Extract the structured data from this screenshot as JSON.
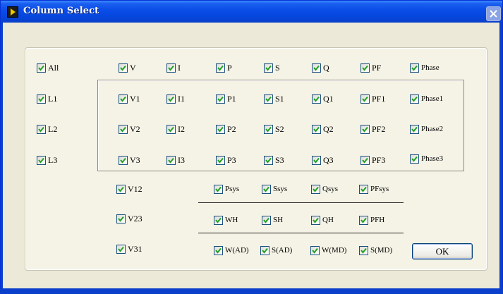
{
  "window": {
    "title": "Column Select"
  },
  "top_row": [
    "All",
    "V",
    "I",
    "P",
    "S",
    "Q",
    "PF",
    "Phase"
  ],
  "left_col": [
    "L1",
    "L2",
    "L3"
  ],
  "phase_rows": [
    [
      "V1",
      "I1",
      "P1",
      "S1",
      "Q1",
      "PF1",
      "Phase1"
    ],
    [
      "V2",
      "I2",
      "P2",
      "S2",
      "Q2",
      "PF2",
      "Phase2"
    ],
    [
      "V3",
      "I3",
      "P3",
      "S3",
      "Q3",
      "PF3",
      "Phase3"
    ]
  ],
  "line_voltages": [
    "V12",
    "V23",
    "V31"
  ],
  "sys_row": [
    "Psys",
    "Ssys",
    "Qsys",
    "PFsys"
  ],
  "energy_row": [
    "WH",
    "SH",
    "QH",
    "PFH"
  ],
  "md_row": [
    "W(AD)",
    "S(AD)",
    "W(MD)",
    "S(MD)"
  ],
  "ok_button": "OK",
  "colors": {
    "titlebar": "#0a4ee8",
    "check": "#21a121",
    "face": "#ece9d8"
  },
  "icons": {
    "app": "labview-run-icon",
    "close": "close-icon",
    "check": "check-icon"
  }
}
